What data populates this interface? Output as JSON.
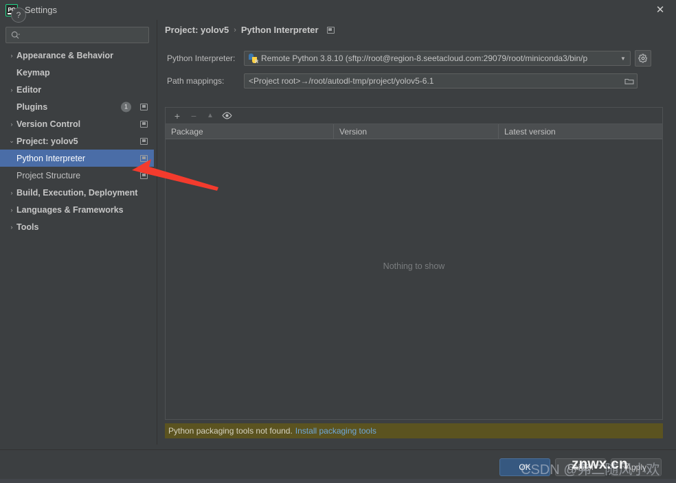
{
  "window": {
    "title": "Settings",
    "logo_text": "PC",
    "close_icon": "✕"
  },
  "search": {
    "value": "",
    "placeholder": ""
  },
  "sidebar": {
    "items": [
      {
        "label": "Appearance & Behavior",
        "arrow": "›",
        "level": 0,
        "expanded": false,
        "has_module_icon": false,
        "badge": null
      },
      {
        "label": "Keymap",
        "arrow": "",
        "level": 0,
        "expanded": false,
        "has_module_icon": false,
        "badge": null
      },
      {
        "label": "Editor",
        "arrow": "›",
        "level": 0,
        "expanded": false,
        "has_module_icon": false,
        "badge": null
      },
      {
        "label": "Plugins",
        "arrow": "",
        "level": 0,
        "expanded": false,
        "has_module_icon": true,
        "badge": "1"
      },
      {
        "label": "Version Control",
        "arrow": "›",
        "level": 0,
        "expanded": false,
        "has_module_icon": true,
        "badge": null
      },
      {
        "label": "Project: yolov5",
        "arrow": "⌄",
        "level": 0,
        "expanded": true,
        "has_module_icon": true,
        "badge": null
      },
      {
        "label": "Python Interpreter",
        "arrow": "",
        "level": 1,
        "expanded": false,
        "has_module_icon": true,
        "badge": null,
        "selected": true
      },
      {
        "label": "Project Structure",
        "arrow": "",
        "level": 1,
        "expanded": false,
        "has_module_icon": true,
        "badge": null
      },
      {
        "label": "Build, Execution, Deployment",
        "arrow": "›",
        "level": 0,
        "expanded": false,
        "has_module_icon": false,
        "badge": null
      },
      {
        "label": "Languages & Frameworks",
        "arrow": "›",
        "level": 0,
        "expanded": false,
        "has_module_icon": false,
        "badge": null
      },
      {
        "label": "Tools",
        "arrow": "›",
        "level": 0,
        "expanded": false,
        "has_module_icon": false,
        "badge": null
      }
    ]
  },
  "breadcrumb": {
    "project": "Project: yolov5",
    "separator": "›",
    "page": "Python Interpreter"
  },
  "interpreter": {
    "label": "Python Interpreter:",
    "value": "Remote Python 3.8.10 (sftp://root@region-8.seetacloud.com:29079/root/miniconda3/bin/p",
    "dropdown_icon": "▼",
    "gear_icon": "gear"
  },
  "path_mappings": {
    "label": "Path mappings:",
    "value": "<Project root>→/root/autodl-tmp/project/yolov5-6.1",
    "browse_icon": "folder"
  },
  "packages": {
    "toolbar": [
      {
        "name": "add-package-button",
        "glyph": "+",
        "enabled": true
      },
      {
        "name": "remove-package-button",
        "glyph": "−",
        "enabled": false
      },
      {
        "name": "upgrade-package-button",
        "glyph": "▲",
        "enabled": false
      },
      {
        "name": "show-early-releases-button",
        "glyph": "👁",
        "enabled": true
      }
    ],
    "columns": [
      "Package",
      "Version",
      "Latest version"
    ],
    "rows": [],
    "empty_text": "Nothing to show"
  },
  "warning": {
    "message": "Python packaging tools not found.",
    "link": "Install packaging tools"
  },
  "footer": {
    "help_label": "?",
    "buttons": [
      {
        "label": "OK",
        "primary": true
      },
      {
        "label": "Cancel",
        "primary": false
      },
      {
        "label": "Apply",
        "primary": false
      }
    ]
  },
  "watermark": {
    "csdn": "CSDN @弗二随风小欢",
    "site": "znwx.cn"
  },
  "colors": {
    "selection_blue": "#4a6da7",
    "accent_button": "#365880",
    "warning_bg": "#5b5320",
    "link": "#6fa8dc",
    "annotation_red": "#f33b2d"
  }
}
